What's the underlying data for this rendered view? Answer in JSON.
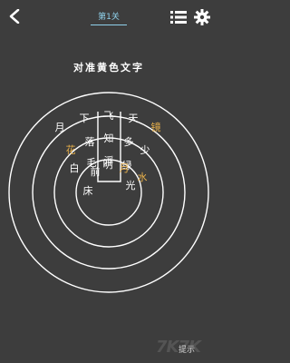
{
  "header": {
    "level_label": "第1关",
    "back_icon": "back-chevron-icon",
    "list_icon": "level-list-icon",
    "settings_icon": "gear-icon"
  },
  "instruction": "对准黄色文字",
  "colors": {
    "background": "#3d3d3d",
    "text": "#ffffff",
    "highlight": "#e8b04a",
    "level_label": "#8fd0ea"
  },
  "rings": {
    "outer": [
      "月",
      "下",
      "飞",
      "天",
      "镜"
    ],
    "ring3": [
      "花",
      "落",
      "知",
      "多",
      "少"
    ],
    "ring2": [
      "白",
      "毛",
      "浮",
      "绿",
      "水"
    ],
    "inner": [
      "床",
      "前",
      "明",
      "月",
      "光"
    ]
  },
  "highlighted": {
    "outer": [
      4
    ],
    "ring3": [
      0
    ],
    "ring2": [
      4
    ],
    "inner": [
      3
    ]
  },
  "hint_label": "提示",
  "watermark": "7K7K"
}
